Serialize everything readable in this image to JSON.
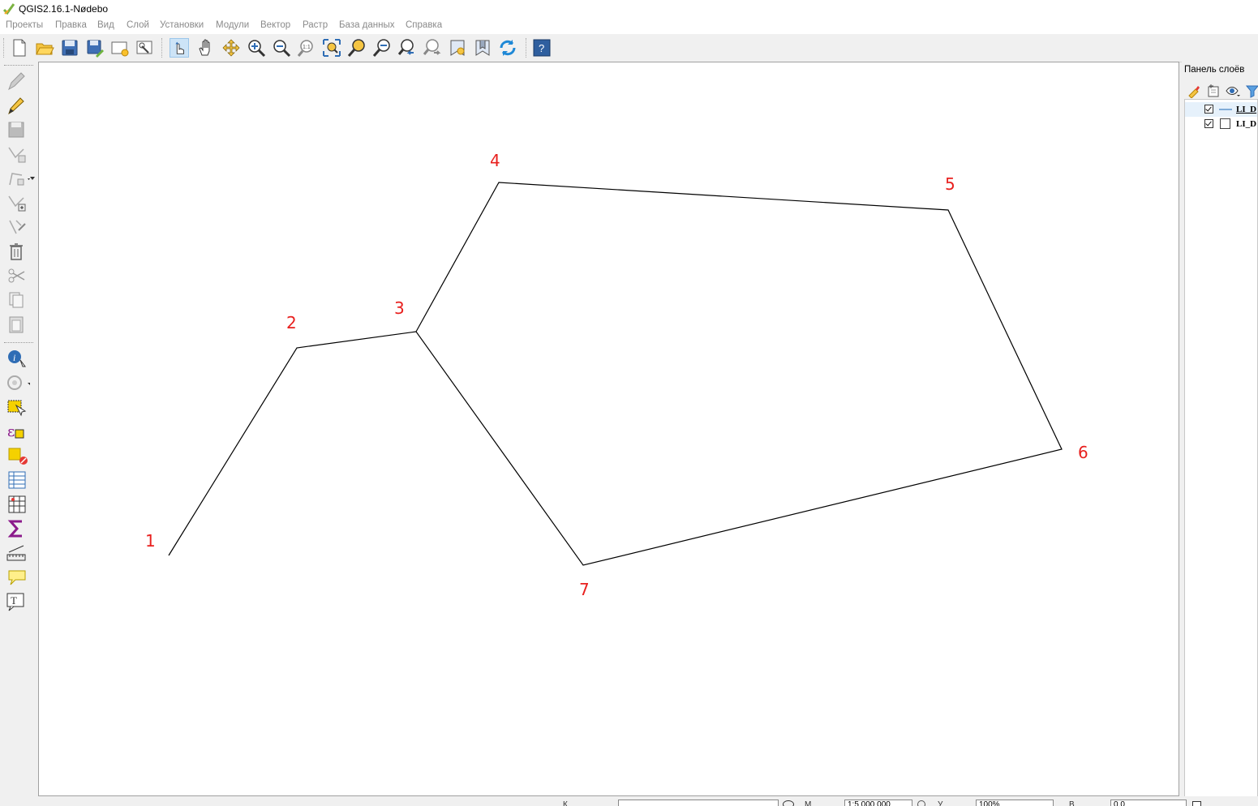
{
  "window": {
    "title": "QGIS2.16.1-Nødebo"
  },
  "menu": [
    "Проекты",
    "Правка",
    "Вид",
    "Слой",
    "Установки",
    "Модули",
    "Вектор",
    "Растр",
    "База данных",
    "Справка"
  ],
  "map": {
    "vertices": [
      {
        "label": "1"
      },
      {
        "label": "2"
      },
      {
        "label": "3"
      },
      {
        "label": "4"
      },
      {
        "label": "5"
      },
      {
        "label": "6"
      },
      {
        "label": "7"
      }
    ],
    "line_color": "#000000",
    "label_color": "#e8201e"
  },
  "layers_panel": {
    "title": "Панель слоёв",
    "layers": [
      {
        "name": "LI_D",
        "checked": true,
        "symbol": "line"
      },
      {
        "name": "LI_D",
        "checked": true,
        "symbol": "polygon"
      }
    ]
  },
  "statusbar": {
    "coord_label": "К",
    "coord_value": "",
    "scale_label": "М",
    "scale_value": "1:5 000 000",
    "magnifier_label": "У",
    "magnifier_value": "100%",
    "rotation_label": "В",
    "rotation_value": "0,0"
  }
}
